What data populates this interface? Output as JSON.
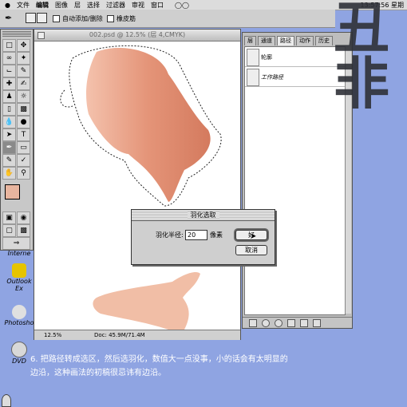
{
  "menubar": {
    "items": [
      "文件",
      "编辑",
      "图像",
      "层",
      "选择",
      "过滤器",
      "审视",
      "窗口"
    ],
    "clock": "13:57:56 星期"
  },
  "options": {
    "auto_add_delete": "自动添加/删除",
    "rubber_band": "橡皮筋"
  },
  "document": {
    "title": "002.psd @ 12.5% (层 4,CMYK)",
    "zoom": "12.5%",
    "doc_size": "Doc: 45.9M/71.4M"
  },
  "paths_panel": {
    "tabs": [
      "层",
      "通道",
      "路径",
      "动作",
      "历史"
    ],
    "active_tab": "路径",
    "paths": [
      "轮廓",
      "工作路径"
    ]
  },
  "dialog": {
    "title": "羽化选取",
    "radius_label": "羽化半径:",
    "radius_value": "20",
    "unit": "像素",
    "ok": "好",
    "cancel": "取消"
  },
  "desktop": {
    "icons": [
      "Interne",
      "Outlook Ex",
      "Photosho",
      "DVD"
    ]
  },
  "caption": {
    "line1": "6. 把路径转成选区，然后选羽化，数值大一点没事，小的话会有太明显的",
    "line2": "边沿，这种画法的初稿很忌讳有边沿。"
  },
  "watermark": "丑非"
}
